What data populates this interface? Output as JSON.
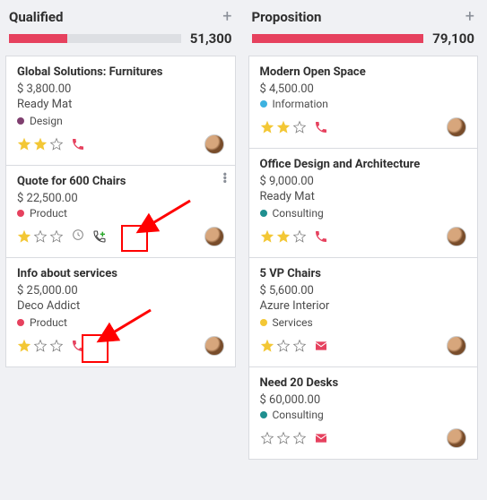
{
  "columns": [
    {
      "title": "Qualified",
      "total": "51,300",
      "progress_pct": 34,
      "cards": [
        {
          "title": "Global Solutions: Furnitures",
          "amount": "$ 3,800.00",
          "customer": "Ready Mat",
          "tag": {
            "label": "Design",
            "color": "#7f3f6f"
          },
          "stars": 2,
          "activity": {
            "icon": "phone",
            "color": "red"
          },
          "kebab": false,
          "schedule_visible": false,
          "highlight": null
        },
        {
          "title": "Quote for 600 Chairs",
          "amount": "$ 22,500.00",
          "customer": "",
          "tag": {
            "label": "Product",
            "color": "#e6415e"
          },
          "stars": 1,
          "activity": {
            "icon": "phone-plus",
            "color": "green"
          },
          "kebab": true,
          "schedule_visible": true,
          "highlight": "phone-plus"
        },
        {
          "title": "Info about services",
          "amount": "$ 25,000.00",
          "customer": "Deco Addict",
          "tag": {
            "label": "Product",
            "color": "#e6415e"
          },
          "stars": 1,
          "activity": {
            "icon": "phone",
            "color": "red"
          },
          "kebab": false,
          "schedule_visible": false,
          "highlight": "phone"
        }
      ]
    },
    {
      "title": "Proposition",
      "total": "79,100",
      "progress_pct": 100,
      "cards": [
        {
          "title": "Modern Open Space",
          "amount": "$ 4,500.00",
          "customer": "",
          "tag": {
            "label": "Information",
            "color": "#3db2e0"
          },
          "stars": 2,
          "activity": {
            "icon": "phone",
            "color": "red"
          },
          "kebab": false,
          "highlight": null
        },
        {
          "title": "Office Design and Architecture",
          "amount": "$ 9,000.00",
          "customer": "Ready Mat",
          "tag": {
            "label": "Consulting",
            "color": "#1e8f8f"
          },
          "stars": 2,
          "activity": {
            "icon": "phone",
            "color": "red"
          },
          "kebab": false,
          "highlight": null
        },
        {
          "title": "5 VP Chairs",
          "amount": "$ 5,600.00",
          "customer": "Azure Interior",
          "tag": {
            "label": "Services",
            "color": "#f3c735"
          },
          "stars": 1,
          "activity": {
            "icon": "email",
            "color": "red"
          },
          "kebab": false,
          "highlight": null
        },
        {
          "title": "Need 20 Desks",
          "amount": "$ 60,000.00",
          "customer": "",
          "tag": {
            "label": "Consulting",
            "color": "#1e8f8f"
          },
          "stars": 0,
          "activity": {
            "icon": "email",
            "color": "red"
          },
          "kebab": false,
          "highlight": null
        }
      ]
    }
  ]
}
